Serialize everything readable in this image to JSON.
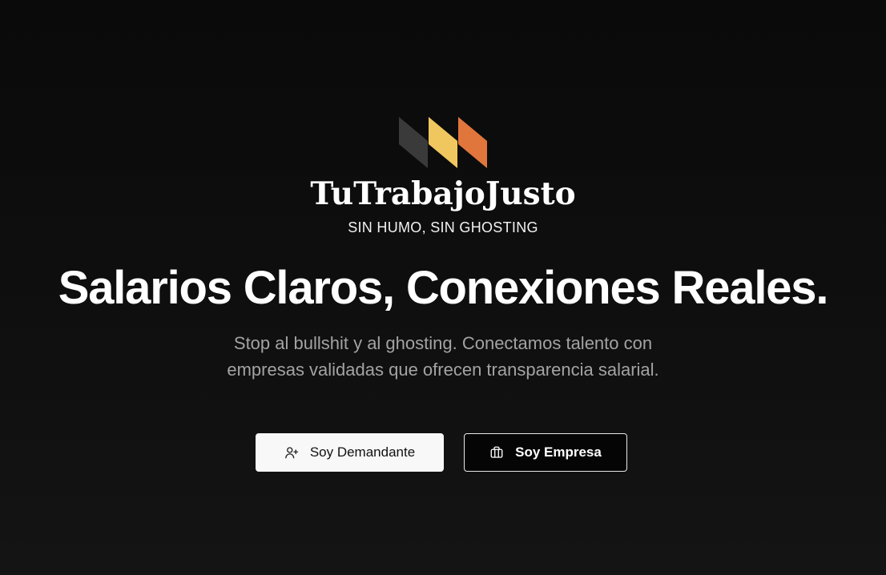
{
  "brand": {
    "name": "TuTrabajoJusto",
    "tagline": "SIN HUMO, SIN GHOSTING",
    "logo_colors": [
      "#3a3a3a",
      "#f0c75e",
      "#e0763c"
    ]
  },
  "hero": {
    "headline": "Salarios Claros, Conexiones Reales.",
    "subtext": "Stop al bullshit y al ghosting. Conectamos talento con empresas validadas que ofrecen transparencia salarial."
  },
  "actions": {
    "candidate": {
      "label": "Soy Demandante",
      "icon": "user-plus-icon"
    },
    "company": {
      "label": "Soy Empresa",
      "icon": "briefcase-icon"
    }
  },
  "colors": {
    "background": "#0e0e0e",
    "text_primary": "#ffffff",
    "text_secondary": "#a3a3a3"
  }
}
